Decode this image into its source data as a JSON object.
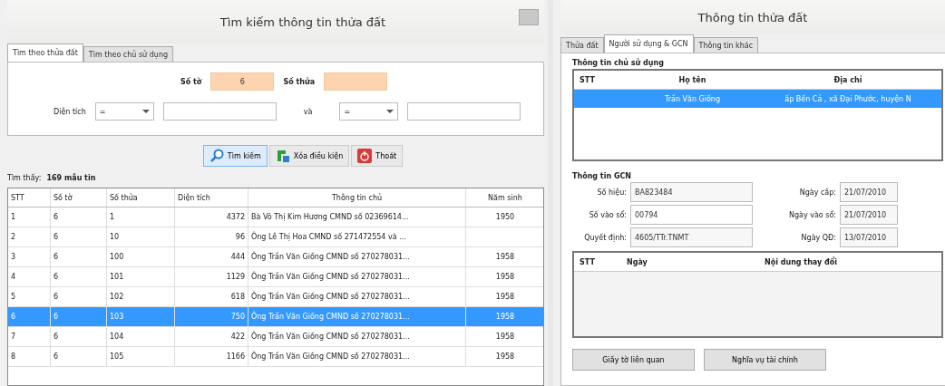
{
  "left": {
    "title": "Tìm kiếm thông tin thửa đất",
    "tabs": [
      {
        "label": "Tìm theo thửa đất",
        "selected": true
      },
      {
        "label": "Tìm theo chủ sử dụng",
        "selected": false
      }
    ],
    "so_to": {
      "label": "Số tờ",
      "value": "6"
    },
    "so_thua": {
      "label": "Số thửa"
    },
    "dien_tich": {
      "label": "Diện tích",
      "operator": "="
    },
    "va": {
      "label": "và",
      "operator": "="
    },
    "buttons": [
      {
        "label": "Tìm kiếm",
        "kind": "search",
        "selected": true
      },
      {
        "label": "Xóa điều kiện",
        "kind": "clear",
        "selected": false
      },
      {
        "label": "Thoát",
        "kind": "exit",
        "selected": false
      }
    ],
    "result": {
      "label": "Tìm thấy:",
      "value": "169 mẫu tin"
    },
    "table": {
      "columns": [
        "STT",
        "Số tờ",
        "Số thửa",
        "Diện tích",
        "Thông tin chủ",
        "Năm sinh"
      ],
      "rows": [
        {
          "cells": [
            "1",
            "6",
            "1",
            "4372",
            "Bà Võ Thị Kim Hương CMND số 02369614...",
            "1950"
          ],
          "selected": false
        },
        {
          "cells": [
            "2",
            "6",
            "10",
            "96",
            "Ông Lê Thị Hoa CMND số 271472554 và ...",
            null
          ],
          "selected": false
        },
        {
          "cells": [
            "3",
            "6",
            "100",
            "444",
            "Ông Trần Văn Giống CMND số 270278031...",
            "1958"
          ],
          "selected": false
        },
        {
          "cells": [
            "4",
            "6",
            "101",
            "1129",
            "Ông Trần Văn Giống CMND số 270278031...",
            "1958"
          ],
          "selected": false
        },
        {
          "cells": [
            "5",
            "6",
            "102",
            "618",
            "Ông Trần Văn Giống CMND số 270278031...",
            "1958"
          ],
          "selected": false
        },
        {
          "cells": [
            "6",
            "6",
            "103",
            "750",
            "Ông Trần Văn Giống CMND số 270278031...",
            "1958"
          ],
          "selected": true
        },
        {
          "cells": [
            "7",
            "6",
            "104",
            "422",
            "Ông Trần Văn Giống CMND số 270278031...",
            "1958"
          ],
          "selected": false
        },
        {
          "cells": [
            "8",
            "6",
            "105",
            "1166",
            "Ông Trần Văn Giống CMND số 270278031...",
            "1958"
          ],
          "selected": false
        }
      ]
    }
  },
  "right": {
    "title": "Thông tin thửa đất",
    "tabs": [
      {
        "label": "Thửa đất",
        "selected": false
      },
      {
        "label": "Người sử dụng & GCN",
        "selected": true
      },
      {
        "label": "Thông tin khác",
        "selected": false
      }
    ],
    "owner": {
      "title": "Thông tin chủ sử dụng",
      "columns": [
        "STT",
        "Họ tên",
        "Địa chỉ"
      ],
      "rows": [
        {
          "cells": [
            null,
            "Trần Văn Giống",
            "ấp Bến Cả , xã Đại Phước, huyện N"
          ],
          "selected": true
        }
      ]
    },
    "gcn": {
      "title": "Thông tin GCN",
      "fields": [
        {
          "label": "Số hiệu:",
          "value": "BA823484"
        },
        {
          "label": "Ngày cấp:",
          "value": "21/07/2010"
        },
        {
          "label": "Số vào sổ:",
          "value": "00794"
        },
        {
          "label": "Ngày vào sổ:",
          "value": "21/07/2010"
        },
        {
          "label": "Quyết định:",
          "value": "4605/TTr.TNMT"
        },
        {
          "label": "Ngày QĐ:",
          "value": "13/07/2010"
        }
      ]
    },
    "changes": {
      "columns": [
        "STT",
        "Ngày",
        "Nội dung thay đổi"
      ]
    },
    "buttons": [
      "Giấy tờ liên quan",
      "Nghĩa vụ tài chính"
    ]
  }
}
